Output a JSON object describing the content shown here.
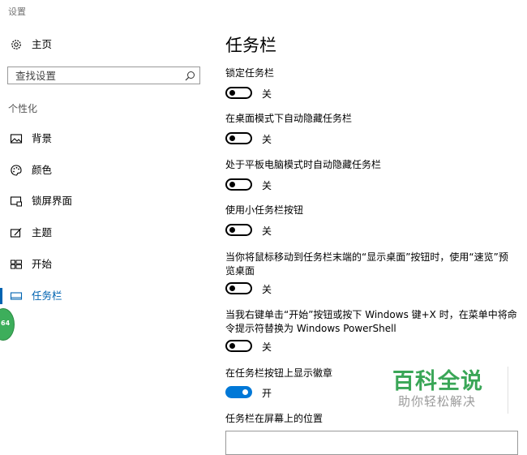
{
  "window": {
    "title": "设置"
  },
  "sidebar": {
    "home_label": "主页",
    "search": {
      "placeholder": "查找设置",
      "value": ""
    },
    "section_header": "个性化",
    "items": [
      {
        "label": "背景",
        "icon": "picture-icon"
      },
      {
        "label": "颜色",
        "icon": "palette-icon"
      },
      {
        "label": "锁屏界面",
        "icon": "lock-screen-icon"
      },
      {
        "label": "主题",
        "icon": "theme-icon"
      },
      {
        "label": "开始",
        "icon": "start-icon"
      },
      {
        "label": "任务栏",
        "icon": "taskbar-icon",
        "active": true
      }
    ],
    "badge": "64"
  },
  "main": {
    "title": "任务栏",
    "settings": [
      {
        "label": "锁定任务栏",
        "state": "关",
        "on": false
      },
      {
        "label": "在桌面模式下自动隐藏任务栏",
        "state": "关",
        "on": false
      },
      {
        "label": "处于平板电脑模式时自动隐藏任务栏",
        "state": "关",
        "on": false
      },
      {
        "label": "使用小任务栏按钮",
        "state": "关",
        "on": false
      },
      {
        "label": "当你将鼠标移动到任务栏末端的“显示桌面”按钮时，使用“速览”预览桌面",
        "state": "关",
        "on": false
      },
      {
        "label": "当我右键单击“开始”按钮或按下 Windows 键+X 时，在菜单中将命令提示符替换为 Windows PowerShell",
        "state": "关",
        "on": false
      },
      {
        "label": "在任务栏按钮上显示徽章",
        "state": "开",
        "on": true
      }
    ],
    "position_label": "任务栏在屏幕上的位置"
  },
  "watermark": {
    "title": "百科全说",
    "subtitle": "助你轻松解决"
  },
  "colors": {
    "accent": "#0078d7",
    "watermark_green": "#3aa657"
  }
}
